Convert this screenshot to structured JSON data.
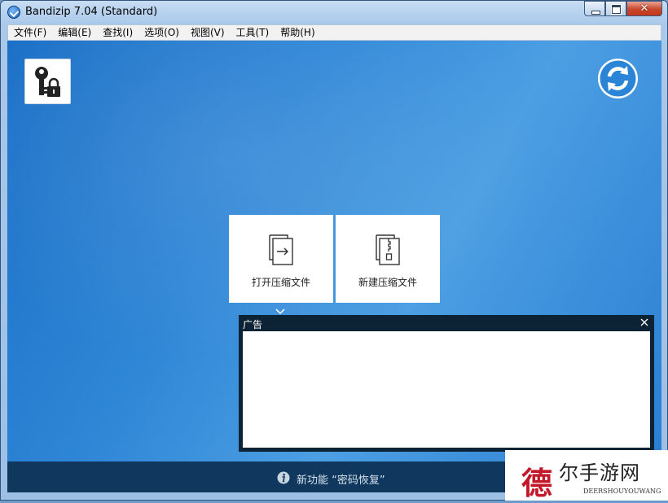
{
  "window": {
    "title": "Bandizip 7.04 (Standard)",
    "close_glyph": "✕"
  },
  "menu": [
    "文件(F)",
    "编辑(E)",
    "查找(I)",
    "选项(O)",
    "视图(V)",
    "工具(T)",
    "帮助(H)"
  ],
  "toolbar": {
    "left_icon": "key-lock-icon",
    "right_icon": "refresh-icon"
  },
  "actions": {
    "open_label": "打开压缩文件",
    "new_label": "新建压缩文件"
  },
  "ad": {
    "title": "广告"
  },
  "status": {
    "text": "新功能 “密码恢复”",
    "icon": "info-icon"
  },
  "watermark": {
    "logo_char": "德",
    "title": "尔手游网",
    "subtitle": "DEERSHOUYOUWANG"
  },
  "colors": {
    "accent": "#2f86d6",
    "ad_panel": "#0c2336",
    "status_bar": "#10375d",
    "close_button": "#c9472b"
  }
}
